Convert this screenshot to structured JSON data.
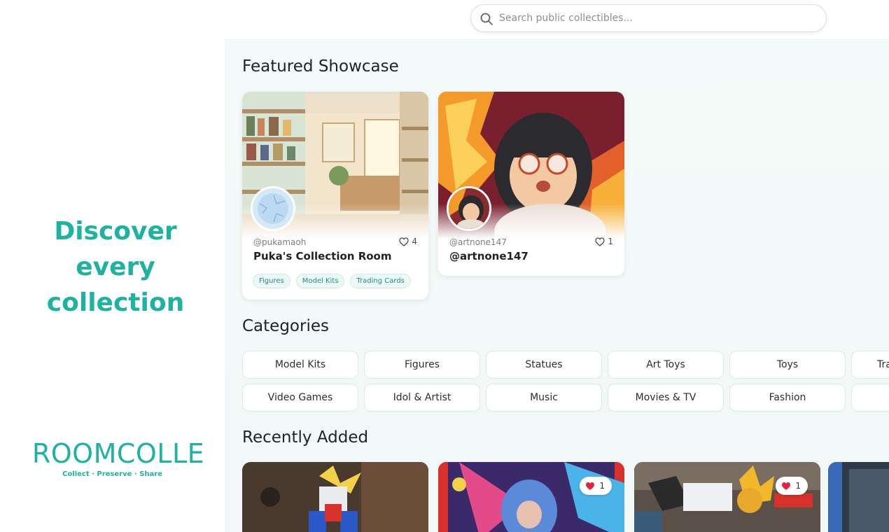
{
  "promo": {
    "tagline_line1": "Discover",
    "tagline_line2": "every",
    "tagline_line3": "collection",
    "logo": "ROOMCOLLE",
    "logo_sub": "Collect · Preserve · Share"
  },
  "search": {
    "placeholder": "Search public collectibles...",
    "value": ""
  },
  "featured": {
    "title": "Featured Showcase",
    "cards": [
      {
        "user": "@pukamaoh",
        "likes": "4",
        "title": "Puka's Collection Room",
        "tags": [
          "Figures",
          "Model Kits",
          "Trading Cards"
        ]
      },
      {
        "user": "@artnone147",
        "likes": "1",
        "title": "@artnone147",
        "tags": []
      }
    ]
  },
  "categories": {
    "title": "Categories",
    "row1": [
      "Model Kits",
      "Figures",
      "Statues",
      "Art Toys",
      "Toys",
      "Tra"
    ],
    "row2": [
      "Video Games",
      "Idol & Artist",
      "Music",
      "Movies & TV",
      "Fashion",
      ""
    ]
  },
  "recent": {
    "title": "Recently Added",
    "items": [
      {
        "likes": ""
      },
      {
        "likes": "1"
      },
      {
        "likes": "1"
      },
      {
        "likes": ""
      }
    ]
  },
  "colors": {
    "brand": "#1eb3a0",
    "heart": "#e5243b"
  }
}
